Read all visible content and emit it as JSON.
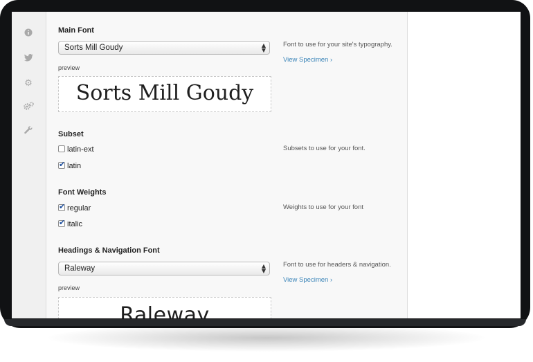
{
  "sidebar": {
    "icons": [
      "info-icon",
      "twitter-icon",
      "gear-icon",
      "gears-icon",
      "wrench-icon"
    ]
  },
  "main_font": {
    "title": "Main Font",
    "selected": "Sorts Mill Goudy",
    "preview_label": "preview",
    "preview_text": "Sorts Mill Goudy",
    "description": "Font to use for your site's typography.",
    "link": "View Specimen"
  },
  "subset": {
    "title": "Subset",
    "options": [
      {
        "label": "latin-ext",
        "checked": false
      },
      {
        "label": "latin",
        "checked": true
      }
    ],
    "description": "Subsets to use for your font."
  },
  "weights": {
    "title": "Font Weights",
    "options": [
      {
        "label": "regular",
        "checked": true
      },
      {
        "label": "italic",
        "checked": true
      }
    ],
    "description": "Weights to use for your font"
  },
  "headings_font": {
    "title": "Headings & Navigation Font",
    "selected": "Raleway",
    "preview_label": "preview",
    "preview_text": "Raleway",
    "description": "Font to use for headers & navigation.",
    "link": "View Specimen"
  }
}
